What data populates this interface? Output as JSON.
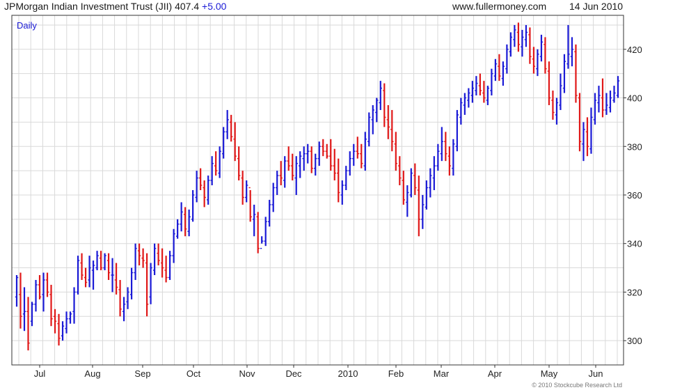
{
  "header": {
    "title": "JPMorgan Indian Investment Trust (JII) 407.4",
    "change": "+5.00",
    "site": "www.fullermoney.com",
    "date": "14 Jun 2010"
  },
  "copyright": "© 2010 Stockcube Research Ltd",
  "colors": {
    "up": "#1a1ad6",
    "down": "#e01818",
    "grid": "#d9d9d9"
  },
  "chart_data": {
    "type": "ohlc-bar",
    "timeframe_label": "Daily",
    "x_tick_labels": [
      "Jul",
      "Aug",
      "Sep",
      "Oct",
      "Nov",
      "Dec",
      "2010",
      "Feb",
      "Mar",
      "Apr",
      "May",
      "Jun"
    ],
    "y_ticks": [
      300,
      320,
      340,
      360,
      380,
      400,
      420
    ],
    "ylim": [
      290,
      434
    ],
    "grid": true,
    "bars": [
      [
        318,
        327,
        314,
        326
      ],
      [
        319,
        328,
        305,
        310
      ],
      [
        311,
        322,
        304,
        312
      ],
      [
        312,
        318,
        296,
        299
      ],
      [
        308,
        316,
        306,
        315
      ],
      [
        315,
        325,
        312,
        323
      ],
      [
        323,
        327,
        317,
        318
      ],
      [
        319,
        328,
        312,
        325
      ],
      [
        325,
        328,
        318,
        320
      ],
      [
        319,
        323,
        306,
        309
      ],
      [
        310,
        313,
        303,
        308
      ],
      [
        307,
        311,
        298,
        301
      ],
      [
        302,
        308,
        300,
        306
      ],
      [
        305,
        312,
        303,
        309
      ],
      [
        309,
        312,
        307,
        311
      ],
      [
        312,
        322,
        307,
        320
      ],
      [
        320,
        335,
        319,
        333
      ],
      [
        332,
        336,
        325,
        327
      ],
      [
        326,
        330,
        322,
        324
      ],
      [
        325,
        335,
        322,
        330
      ],
      [
        329,
        333,
        321,
        331
      ],
      [
        330,
        337,
        329,
        335
      ],
      [
        334,
        337,
        329,
        330
      ],
      [
        330,
        336,
        329,
        335
      ],
      [
        333,
        336,
        325,
        328
      ],
      [
        327,
        334,
        320,
        327
      ],
      [
        325,
        332,
        319,
        322
      ],
      [
        321,
        325,
        310,
        313
      ],
      [
        312,
        318,
        308,
        315
      ],
      [
        316,
        322,
        313,
        320
      ],
      [
        319,
        330,
        317,
        328
      ],
      [
        328,
        340,
        325,
        338
      ],
      [
        337,
        340,
        331,
        335
      ],
      [
        334,
        338,
        330,
        333
      ],
      [
        332,
        336,
        310,
        315
      ],
      [
        318,
        332,
        315,
        330
      ],
      [
        329,
        340,
        327,
        338
      ],
      [
        336,
        340,
        331,
        333
      ],
      [
        332,
        338,
        326,
        330
      ],
      [
        329,
        335,
        324,
        326
      ],
      [
        326,
        337,
        325,
        335
      ],
      [
        335,
        346,
        332,
        344
      ],
      [
        343,
        350,
        342,
        348
      ],
      [
        348,
        357,
        345,
        353
      ],
      [
        352,
        355,
        343,
        346
      ],
      [
        345,
        354,
        343,
        351
      ],
      [
        350,
        362,
        349,
        360
      ],
      [
        359,
        370,
        357,
        367
      ],
      [
        367,
        371,
        362,
        364
      ],
      [
        363,
        366,
        355,
        359
      ],
      [
        358,
        368,
        356,
        366
      ],
      [
        366,
        376,
        364,
        373
      ],
      [
        372,
        378,
        368,
        370
      ],
      [
        369,
        380,
        367,
        378
      ],
      [
        377,
        388,
        375,
        386
      ],
      [
        386,
        395,
        383,
        391
      ],
      [
        390,
        393,
        382,
        384
      ],
      [
        383,
        390,
        374,
        376
      ],
      [
        375,
        380,
        366,
        368
      ],
      [
        367,
        370,
        356,
        359
      ],
      [
        359,
        366,
        357,
        364
      ],
      [
        363,
        362,
        349,
        351
      ],
      [
        350,
        356,
        343,
        352
      ],
      [
        351,
        353,
        336,
        338
      ],
      [
        338,
        343,
        340,
        341
      ],
      [
        341,
        351,
        339,
        349
      ],
      [
        349,
        358,
        347,
        356
      ],
      [
        356,
        365,
        353,
        363
      ],
      [
        363,
        370,
        360,
        368
      ],
      [
        368,
        374,
        364,
        367
      ],
      [
        366,
        376,
        363,
        374
      ],
      [
        374,
        380,
        370,
        372
      ],
      [
        372,
        377,
        366,
        368
      ],
      [
        367,
        376,
        360,
        373
      ],
      [
        372,
        378,
        367,
        376
      ],
      [
        375,
        380,
        370,
        377
      ],
      [
        377,
        381,
        373,
        378
      ],
      [
        378,
        380,
        369,
        371
      ],
      [
        371,
        377,
        368,
        375
      ],
      [
        375,
        382,
        372,
        380
      ],
      [
        380,
        383,
        376,
        378
      ],
      [
        378,
        381,
        375,
        376
      ],
      [
        376,
        383,
        370,
        372
      ],
      [
        372,
        379,
        366,
        369
      ],
      [
        369,
        375,
        357,
        361
      ],
      [
        360,
        366,
        356,
        364
      ],
      [
        364,
        372,
        362,
        370
      ],
      [
        370,
        378,
        368,
        375
      ],
      [
        375,
        381,
        372,
        378
      ],
      [
        378,
        384,
        375,
        377
      ],
      [
        377,
        381,
        371,
        373
      ],
      [
        372,
        386,
        370,
        383
      ],
      [
        382,
        394,
        380,
        392
      ],
      [
        391,
        397,
        385,
        395
      ],
      [
        394,
        400,
        390,
        399
      ],
      [
        398,
        407,
        395,
        404
      ],
      [
        403,
        406,
        388,
        392
      ],
      [
        391,
        397,
        383,
        388
      ],
      [
        387,
        395,
        378,
        382
      ],
      [
        381,
        386,
        370,
        373
      ],
      [
        372,
        376,
        364,
        367
      ],
      [
        366,
        370,
        356,
        358
      ],
      [
        357,
        364,
        351,
        361
      ],
      [
        360,
        371,
        359,
        369
      ],
      [
        368,
        373,
        360,
        363
      ],
      [
        362,
        368,
        343,
        350
      ],
      [
        350,
        360,
        346,
        356
      ],
      [
        355,
        366,
        354,
        363
      ],
      [
        363,
        371,
        359,
        368
      ],
      [
        367,
        376,
        362,
        372
      ],
      [
        372,
        381,
        370,
        378
      ],
      [
        377,
        388,
        374,
        382
      ],
      [
        382,
        386,
        374,
        377
      ],
      [
        376,
        380,
        368,
        372
      ],
      [
        371,
        383,
        368,
        381
      ],
      [
        380,
        395,
        378,
        393
      ],
      [
        392,
        400,
        389,
        398
      ],
      [
        397,
        402,
        393,
        400
      ],
      [
        399,
        404,
        396,
        402
      ],
      [
        401,
        407,
        398,
        404
      ],
      [
        403,
        409,
        401,
        406
      ],
      [
        405,
        410,
        401,
        403
      ],
      [
        402,
        407,
        398,
        400
      ],
      [
        399,
        405,
        397,
        404
      ],
      [
        403,
        412,
        401,
        410
      ],
      [
        409,
        416,
        407,
        414
      ],
      [
        413,
        418,
        407,
        409
      ],
      [
        408,
        415,
        405,
        413
      ],
      [
        412,
        422,
        410,
        420
      ],
      [
        419,
        427,
        417,
        425
      ],
      [
        424,
        430,
        421,
        428
      ],
      [
        427,
        431,
        419,
        422
      ],
      [
        421,
        428,
        417,
        425
      ],
      [
        424,
        430,
        421,
        427
      ],
      [
        426,
        429,
        414,
        417
      ],
      [
        416,
        421,
        410,
        413
      ],
      [
        412,
        420,
        409,
        418
      ],
      [
        417,
        426,
        415,
        423
      ],
      [
        422,
        425,
        410,
        412
      ],
      [
        411,
        415,
        397,
        400
      ],
      [
        399,
        403,
        391,
        394
      ],
      [
        393,
        400,
        389,
        398
      ],
      [
        397,
        410,
        395,
        405
      ],
      [
        404,
        418,
        402,
        415
      ],
      [
        414,
        430,
        412,
        418
      ],
      [
        417,
        425,
        413,
        420
      ],
      [
        419,
        422,
        398,
        401
      ],
      [
        400,
        402,
        378,
        382
      ],
      [
        381,
        390,
        374,
        387
      ],
      [
        386,
        392,
        376,
        380
      ],
      [
        379,
        396,
        377,
        392
      ],
      [
        391,
        402,
        389,
        399
      ],
      [
        398,
        405,
        394,
        401
      ],
      [
        400,
        408,
        392,
        395
      ],
      [
        395,
        402,
        393,
        397
      ],
      [
        396,
        403,
        394,
        400
      ],
      [
        399,
        405,
        398,
        402
      ],
      [
        401,
        409,
        400,
        407
      ]
    ]
  }
}
